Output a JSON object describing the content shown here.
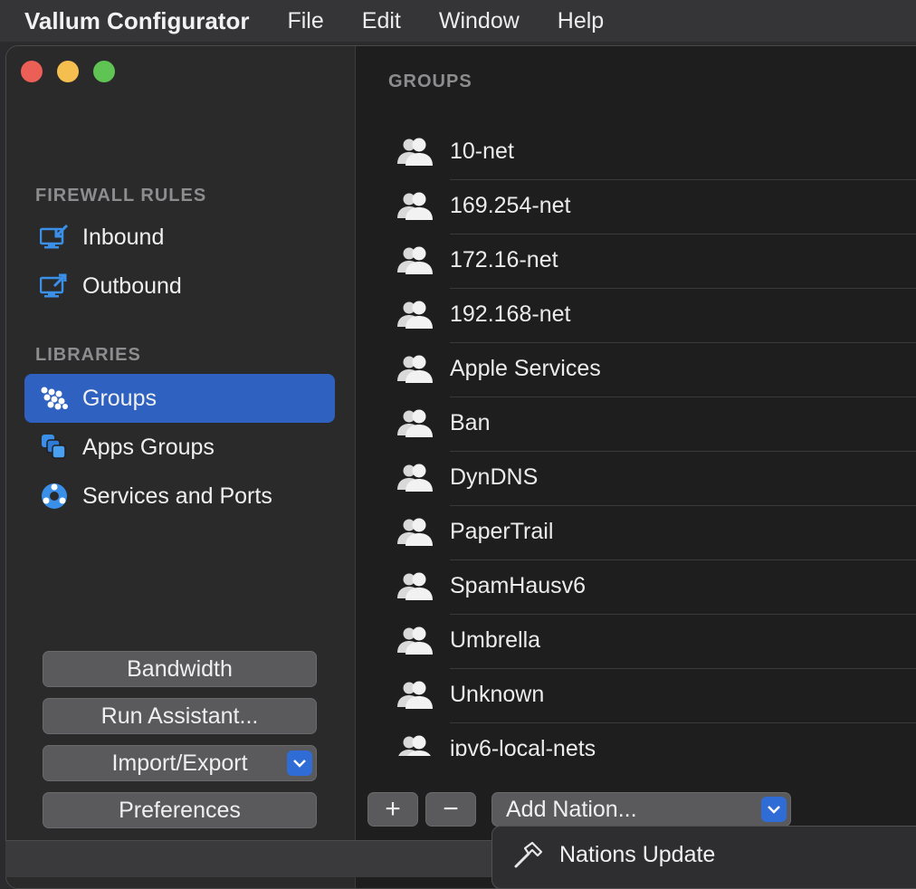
{
  "menubar": {
    "app_name": "Vallum Configurator",
    "items": [
      "File",
      "Edit",
      "Window",
      "Help"
    ]
  },
  "sidebar": {
    "firewall_heading": "FIREWALL RULES",
    "firewall_items": [
      {
        "label": "Inbound",
        "icon": "inbound-monitor-icon"
      },
      {
        "label": "Outbound",
        "icon": "outbound-monitor-icon"
      }
    ],
    "libraries_heading": "LIBRARIES",
    "library_items": [
      {
        "label": "Groups",
        "icon": "groups-icon",
        "selected": true
      },
      {
        "label": "Apps Groups",
        "icon": "apps-groups-icon",
        "selected": false
      },
      {
        "label": "Services and Ports",
        "icon": "services-icon",
        "selected": false
      }
    ],
    "buttons": {
      "bandwidth": "Bandwidth",
      "run_assistant": "Run Assistant...",
      "import_export": "Import/Export",
      "preferences": "Preferences"
    }
  },
  "main": {
    "heading": "GROUPS",
    "groups": [
      "10-net",
      "169.254-net",
      "172.16-net",
      "192.168-net",
      "Apple Services",
      "Ban",
      "DynDNS",
      "PaperTrail",
      "SpamHausv6",
      "Umbrella",
      "Unknown",
      "ipv6-local-nets"
    ],
    "toolbar": {
      "add_symbol": "+",
      "remove_symbol": "−",
      "add_nation": "Add Nation..."
    }
  },
  "dropdown_menu": {
    "items": [
      {
        "label": "Nations Update",
        "icon": "hammer-icon"
      }
    ]
  },
  "colors": {
    "accent": "#2f62c0",
    "traffic_red": "#ec5f57",
    "traffic_yellow": "#f4bf4f",
    "traffic_green": "#5fc454"
  }
}
